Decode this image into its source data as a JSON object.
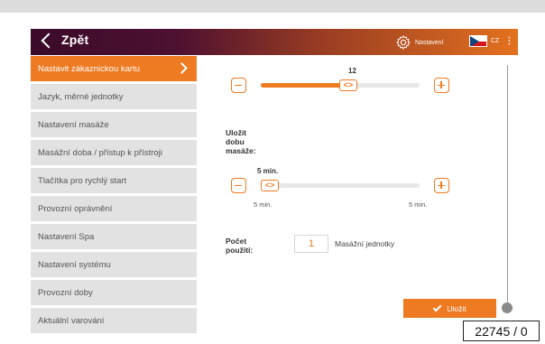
{
  "header": {
    "back_label": "Zpět",
    "settings_label": "Nastavení",
    "language_code": "CZ",
    "menu_glyph": "⋮",
    "gradient_start": "#3b0b2a",
    "gradient_end": "#e3711f"
  },
  "sidebar": {
    "items": [
      {
        "label": "Nastavit zákaznickou kartu",
        "active": true
      },
      {
        "label": "Jazyk, měrné jednotky"
      },
      {
        "label": "Nastavení masáže"
      },
      {
        "label": "Masážní doba / přístup k přístroji"
      },
      {
        "label": "Tlačítka pro rychlý start"
      },
      {
        "label": "Provozní oprávnění"
      },
      {
        "label": "Nastavení Spa"
      },
      {
        "label": "Nastavení systému"
      },
      {
        "label": "Provozní doby"
      },
      {
        "label": "Aktuální varování"
      }
    ]
  },
  "slider1": {
    "value_label": "12",
    "thumb_glyph": "<>",
    "level": 0.53
  },
  "save_time": {
    "label_line1": "Uložit",
    "label_line2": "dobu",
    "label_line3": "masáže:"
  },
  "slider2": {
    "value_label": "5 min.",
    "min_label": "5 min.",
    "max_label": "5 min.",
    "thumb_glyph": "<>",
    "level": 0.0
  },
  "usage": {
    "label_line1": "Počet",
    "label_line2": "použití:",
    "value": "1",
    "unit": "Masážní jednotky"
  },
  "save_button": {
    "label": "Uložit"
  },
  "overlay": {
    "counter": "22745 / 0"
  },
  "colors": {
    "accent": "#ee7a22",
    "sidebar_bg": "#e2e2e2"
  },
  "icons": [
    "chevron-left-icon",
    "gear-icon",
    "flag-cz-icon",
    "kebab-icon",
    "chevron-right-icon",
    "minus-icon",
    "plus-icon",
    "check-icon"
  ]
}
